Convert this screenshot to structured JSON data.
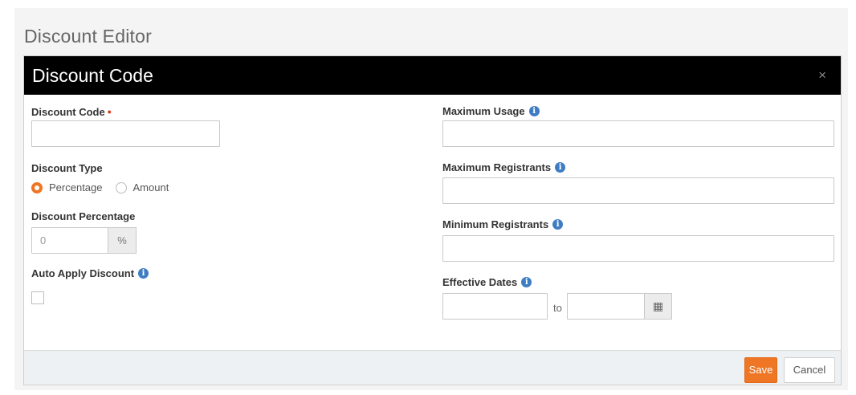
{
  "page": {
    "title": "Discount Editor"
  },
  "modal": {
    "title": "Discount Code",
    "close_glyph": "×"
  },
  "form": {
    "discount_code": {
      "label": "Discount Code",
      "required_mark": "•",
      "value": ""
    },
    "discount_type": {
      "label": "Discount Type",
      "options": [
        {
          "label": "Percentage",
          "checked": true
        },
        {
          "label": "Amount",
          "checked": false
        }
      ]
    },
    "discount_percentage": {
      "label": "Discount Percentage",
      "value": "0",
      "addon": "%"
    },
    "auto_apply": {
      "label": "Auto Apply Discount",
      "checked": false
    },
    "maximum_usage": {
      "label": "Maximum Usage",
      "value": ""
    },
    "maximum_registrants": {
      "label": "Maximum Registrants",
      "value": ""
    },
    "minimum_registrants": {
      "label": "Minimum Registrants",
      "value": ""
    },
    "effective_dates": {
      "label": "Effective Dates",
      "to_label": "to",
      "start": "",
      "end": ""
    }
  },
  "footer": {
    "save_label": "Save",
    "cancel_label": "Cancel"
  },
  "icons": {
    "info": "info-icon",
    "calendar": "calendar-icon",
    "close": "close-icon"
  },
  "colors": {
    "accent": "#ee7624",
    "info": "#3e7cc3",
    "header_bg": "#000000",
    "required": "#d9381e"
  }
}
